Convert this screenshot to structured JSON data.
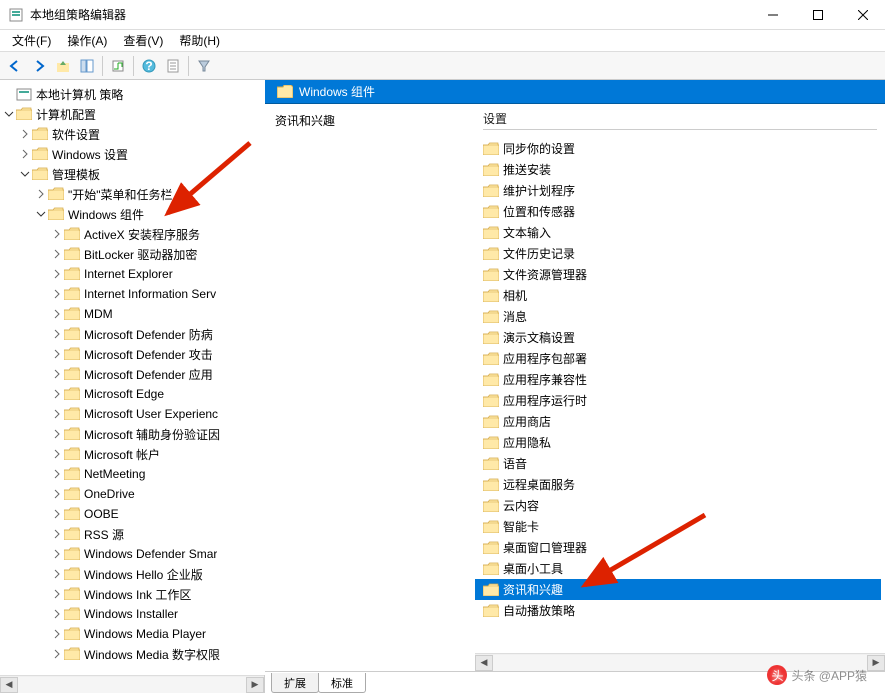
{
  "window": {
    "title": "本地组策略编辑器",
    "menus": [
      "文件(F)",
      "操作(A)",
      "查看(V)",
      "帮助(H)"
    ]
  },
  "toolbar_icons": [
    "back-icon",
    "forward-icon",
    "up-icon",
    "show-hide-icon",
    "export-icon",
    "refresh-icon",
    "help-icon",
    "properties-icon",
    "filter-icon"
  ],
  "tree": {
    "root": "本地计算机 策略",
    "computer_config": "计算机配置",
    "software_settings": "软件设置",
    "windows_settings": "Windows 设置",
    "admin_templates": "管理模板",
    "start_menu": "\"开始\"菜单和任务栏",
    "windows_components": "Windows 组件",
    "components": [
      "ActiveX 安装程序服务",
      "BitLocker 驱动器加密",
      "Internet Explorer",
      "Internet Information Serv",
      "MDM",
      "Microsoft Defender 防病",
      "Microsoft Defender 攻击",
      "Microsoft Defender 应用",
      "Microsoft Edge",
      "Microsoft User Experienc",
      "Microsoft 辅助身份验证因",
      "Microsoft 帐户",
      "NetMeeting",
      "OneDrive",
      "OOBE",
      "RSS 源",
      "Windows Defender Smar",
      "Windows Hello 企业版",
      "Windows Ink 工作区",
      "Windows Installer",
      "Windows Media Player",
      "Windows Media 数字权限"
    ]
  },
  "detail": {
    "header": "Windows 组件",
    "left_title": "资讯和兴趣",
    "right_header": "设置",
    "selected_index": 21,
    "items": [
      "同步你的设置",
      "推送安装",
      "维护计划程序",
      "位置和传感器",
      "文本输入",
      "文件历史记录",
      "文件资源管理器",
      "相机",
      "消息",
      "演示文稿设置",
      "应用程序包部署",
      "应用程序兼容性",
      "应用程序运行时",
      "应用商店",
      "应用隐私",
      "语音",
      "远程桌面服务",
      "云内容",
      "智能卡",
      "桌面窗口管理器",
      "桌面小工具",
      "资讯和兴趣",
      "自动播放策略"
    ],
    "tabs": [
      "扩展",
      "标准"
    ]
  },
  "watermark": "头条 @APP猿"
}
